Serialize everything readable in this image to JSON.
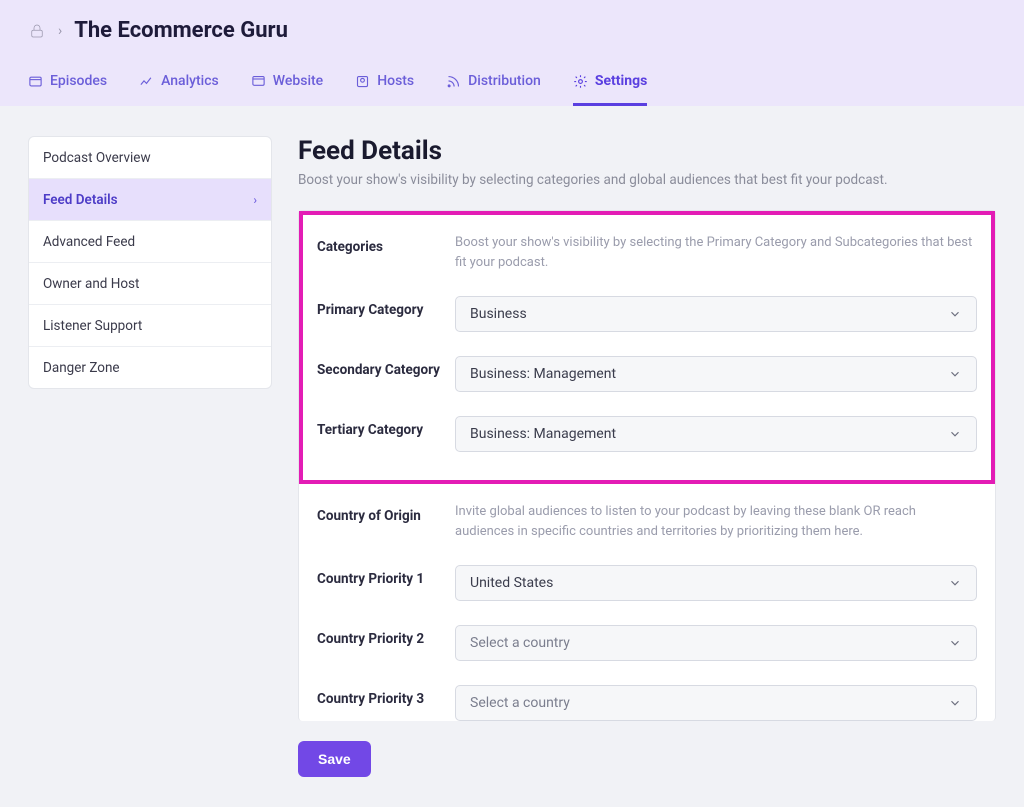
{
  "breadcrumb": {
    "title": "The Ecommerce Guru"
  },
  "tabs": [
    {
      "label": "Episodes"
    },
    {
      "label": "Analytics"
    },
    {
      "label": "Website"
    },
    {
      "label": "Hosts"
    },
    {
      "label": "Distribution"
    },
    {
      "label": "Settings",
      "active": true
    }
  ],
  "sidenav": [
    {
      "label": "Podcast Overview"
    },
    {
      "label": "Feed Details",
      "active": true
    },
    {
      "label": "Advanced Feed"
    },
    {
      "label": "Owner and Host"
    },
    {
      "label": "Listener Support"
    },
    {
      "label": "Danger Zone"
    }
  ],
  "page": {
    "title": "Feed Details",
    "subtitle": "Boost your show's visibility by selecting categories and global audiences that best fit your podcast."
  },
  "categories": {
    "heading": "Categories",
    "desc": "Boost your show's visibility by selecting the Primary Category and Subcategories that best fit your podcast.",
    "primary_label": "Primary Category",
    "primary_value": "Business",
    "secondary_label": "Secondary Category",
    "secondary_value": "Business: Management",
    "tertiary_label": "Tertiary Category",
    "tertiary_value": "Business: Management"
  },
  "country": {
    "heading": "Country of Origin",
    "desc": "Invite global audiences to listen to your podcast by leaving these blank OR reach audiences in specific countries and territories by prioritizing them here.",
    "p1_label": "Country Priority 1",
    "p1_value": "United States",
    "p2_label": "Country Priority 2",
    "p2_value": "Select a country",
    "p3_label": "Country Priority 3",
    "p3_value": "Select a country"
  },
  "actions": {
    "save": "Save"
  }
}
